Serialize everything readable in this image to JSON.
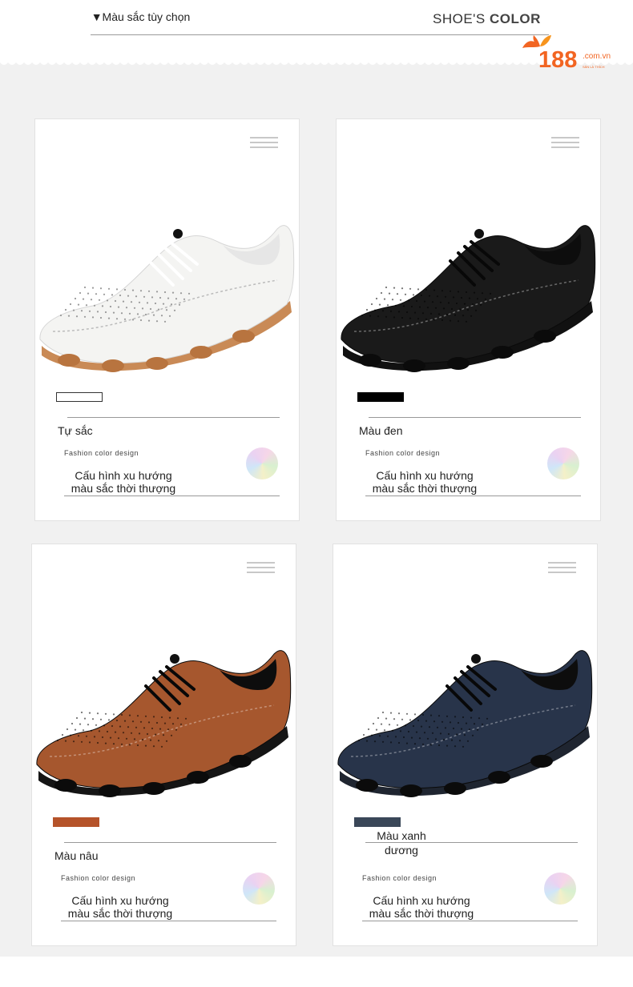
{
  "header": {
    "tag": "▼Màu sắc tùy chọn",
    "title_light": "SHOE'S ",
    "title_bold": "COLOR"
  },
  "logo": {
    "brand": "188",
    "suffix": ".com.vn",
    "slogan": "SĂN LÀ THÍCH"
  },
  "cards": [
    {
      "name": "Tự sắc",
      "subtitle": "Fashion color design",
      "description": "Cấu hình xu hướng màu sắc thời thượng",
      "swatch_color": "#ffffff",
      "shoe_color": "#f4f4f2",
      "sole_color": "#c98a56"
    },
    {
      "name": "Màu đen",
      "subtitle": "Fashion color design",
      "description": "Cấu hình xu hướng màu sắc thời thượng",
      "swatch_color": "#000000",
      "shoe_color": "#1a1a1a",
      "sole_color": "#111111"
    },
    {
      "name": "Màu nâu",
      "subtitle": "Fashion color design",
      "description": "Cấu hình xu hướng màu sắc thời thượng",
      "swatch_color": "#b5532a",
      "shoe_color": "#a6572e",
      "sole_color": "#151515"
    },
    {
      "name": "Màu xanh dương",
      "subtitle": "Fashion color design",
      "description": "Cấu hình xu hướng màu sắc thời thượng",
      "swatch_color": "#3a4758",
      "shoe_color": "#28344a",
      "sole_color": "#1f2530"
    }
  ],
  "colors": {
    "logo_orange": "#f26522",
    "background_gray": "#f1f1f1"
  }
}
